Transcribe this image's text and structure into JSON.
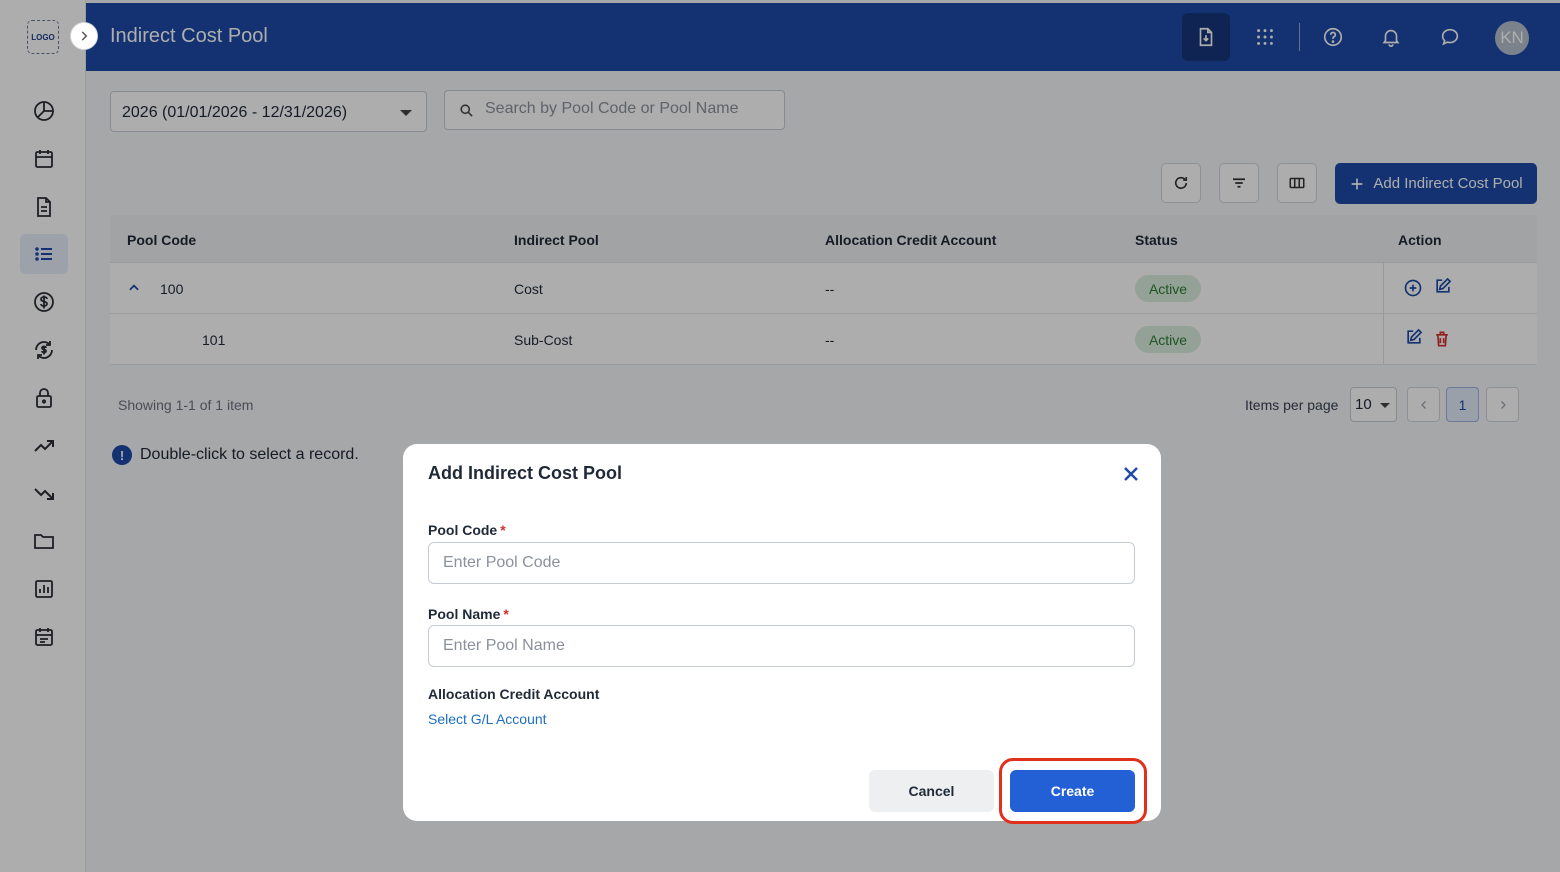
{
  "app": {
    "logo_text": "LOGO",
    "page_title": "Indirect Cost Pool",
    "avatar_initials": "KN",
    "accent_color": "#1e4ba8"
  },
  "sidebar": {
    "items": [
      {
        "icon": "dashboard-icon"
      },
      {
        "icon": "calendar-icon"
      },
      {
        "icon": "document-icon"
      },
      {
        "icon": "list-icon",
        "active": true
      },
      {
        "icon": "dollar-icon"
      },
      {
        "icon": "currency-exchange-icon"
      },
      {
        "icon": "lock-icon"
      },
      {
        "icon": "trending-up-icon"
      },
      {
        "icon": "trending-down-icon"
      },
      {
        "icon": "folder-icon"
      },
      {
        "icon": "report-chart-icon"
      },
      {
        "icon": "schedule-icon"
      }
    ]
  },
  "filters": {
    "year_value": "2026 (01/01/2026 - 12/31/2026)",
    "search_placeholder": "Search by Pool Code or Pool Name"
  },
  "toolbar": {
    "add_label": "Add Indirect Cost Pool"
  },
  "table": {
    "columns": [
      "Pool Code",
      "Indirect Pool",
      "Allocation Credit Account",
      "Status",
      "Action"
    ],
    "rows": [
      {
        "code": "100",
        "pool": "Cost",
        "account": "--",
        "status": "Active",
        "expanded": true
      },
      {
        "code": "101",
        "pool": "Sub-Cost",
        "account": "--",
        "status": "Active",
        "child": true
      }
    ]
  },
  "pagination": {
    "showing": "Showing 1-1 of 1 item",
    "items_per_page_label": "Items per page",
    "items_per_page": "10",
    "current_page": "1"
  },
  "hint": {
    "icon_text": "!",
    "text": "Double-click to select a record."
  },
  "modal": {
    "title": "Add Indirect Cost Pool",
    "pool_code_label": "Pool Code",
    "pool_code_placeholder": "Enter Pool Code",
    "pool_name_label": "Pool Name",
    "pool_name_placeholder": "Enter Pool Name",
    "required_mark": "*",
    "account_label": "Allocation Credit Account",
    "account_link": "Select G/L Account",
    "cancel_label": "Cancel",
    "create_label": "Create"
  }
}
